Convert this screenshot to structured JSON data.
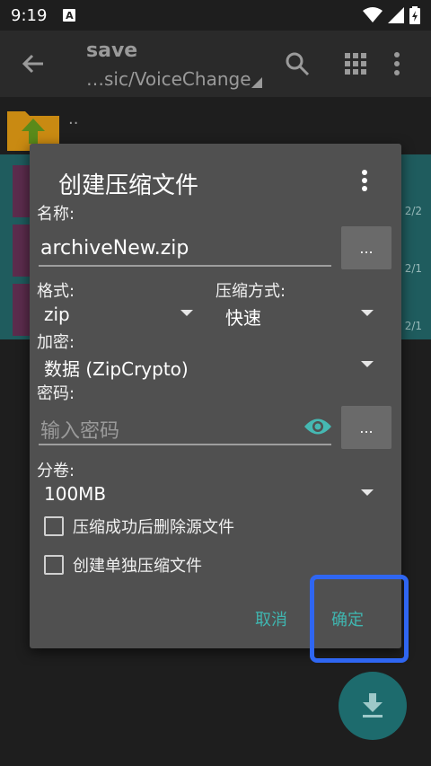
{
  "status_bar": {
    "time": "9:19",
    "notification_letter": "A"
  },
  "toolbar": {
    "title": "save",
    "path": "…sic/VoiceChange"
  },
  "file_list": {
    "up_label": "..",
    "rows": [
      {
        "side_text": "2/2"
      },
      {
        "side_text": "2/1"
      },
      {
        "side_text": "2/1"
      }
    ]
  },
  "dialog": {
    "title": "创建压缩文件",
    "name_label": "名称:",
    "name_value": "archiveNew.zip",
    "browse_label": "...",
    "format_label": "格式:",
    "format_value": "zip",
    "method_label": "压缩方式:",
    "method_value": "快速",
    "encryption_label": "加密:",
    "encryption_value": "数据 (ZipCrypto)",
    "password_label": "密码:",
    "password_placeholder": "输入密码",
    "password_browse_label": "...",
    "split_label": "分卷:",
    "split_value": "100MB",
    "delete_source_label": "压缩成功后删除源文件",
    "separate_archive_label": "创建单独压缩文件",
    "cancel_label": "取消",
    "confirm_label": "确定"
  },
  "colors": {
    "accent": "#3fb6b0",
    "highlight": "#2f66f2",
    "dialog_bg": "#505050"
  }
}
